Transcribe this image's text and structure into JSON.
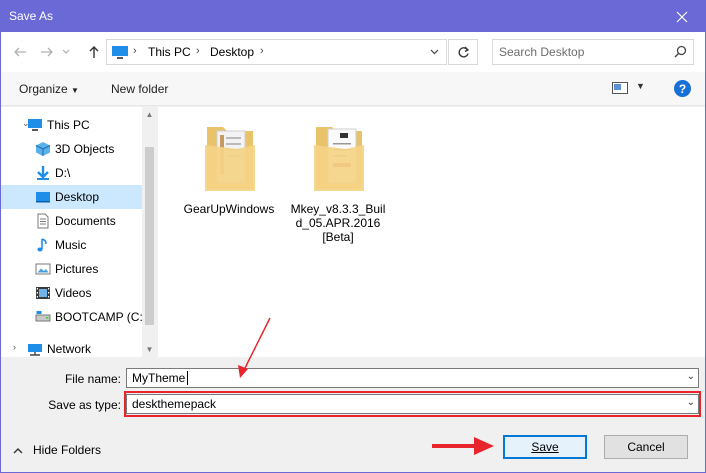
{
  "window": {
    "title": "Save As"
  },
  "navigation": {
    "address_segments": [
      "This PC",
      "Desktop"
    ],
    "search_placeholder": "Search Desktop"
  },
  "toolbar": {
    "organize_label": "Organize",
    "new_folder_label": "New folder",
    "help_label": "?"
  },
  "sidebar": {
    "items": [
      {
        "label": "This PC",
        "icon": "pc-icon"
      },
      {
        "label": "3D Objects",
        "icon": "cube-icon"
      },
      {
        "label": "D:\\",
        "icon": "download-drive-icon"
      },
      {
        "label": "Desktop",
        "icon": "desktop-icon",
        "selected": true
      },
      {
        "label": "Documents",
        "icon": "document-icon"
      },
      {
        "label": "Music",
        "icon": "music-icon"
      },
      {
        "label": "Pictures",
        "icon": "pictures-icon"
      },
      {
        "label": "Videos",
        "icon": "videos-icon"
      },
      {
        "label": "BOOTCAMP (C:)",
        "icon": "drive-icon"
      },
      {
        "label": "Network",
        "icon": "network-icon"
      }
    ]
  },
  "files": [
    {
      "name": "GearUpWindows"
    },
    {
      "name": "Mkey_v8.3.3_Build_05.APR.2016[Beta]"
    }
  ],
  "form": {
    "file_name_label": "File name:",
    "file_name_value": "MyTheme",
    "save_type_label": "Save as type:",
    "save_type_value": "deskthemepack"
  },
  "footer": {
    "hide_folders_label": "Hide Folders",
    "save_label": "Save",
    "cancel_label": "Cancel"
  },
  "colors": {
    "titlebar": "#6b69d6",
    "selection": "#cce8ff",
    "annotation_red": "#e8252c",
    "help_blue": "#1670d6"
  }
}
